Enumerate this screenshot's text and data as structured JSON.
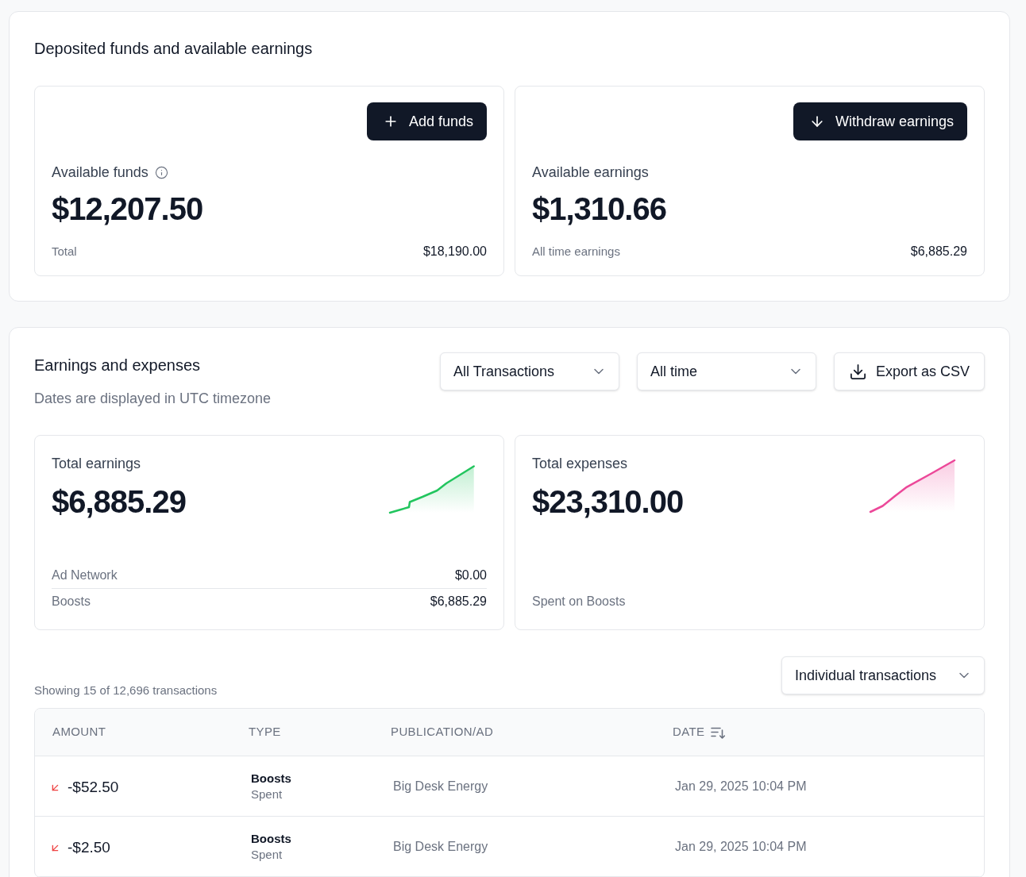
{
  "funds_section": {
    "title": "Deposited funds and available earnings",
    "cards": [
      {
        "kind": "funds",
        "button": "Add funds",
        "label": "Available funds",
        "info_icon": true,
        "amount": "$12,207.50",
        "footer_label": "Total",
        "footer_value": "$18,190.00"
      },
      {
        "kind": "earnings",
        "button": "Withdraw earnings",
        "label": "Available earnings",
        "info_icon": false,
        "amount": "$1,310.66",
        "footer_label": "All time earnings",
        "footer_value": "$6,885.29"
      }
    ]
  },
  "earnings_section": {
    "title": "Earnings and expenses",
    "subtitle": "Dates are displayed in UTC timezone",
    "filters": [
      {
        "value": "All Transactions"
      },
      {
        "value": "All time"
      }
    ],
    "export_button": "Export as CSV",
    "cards": [
      {
        "kind": "earnings",
        "label": "Total earnings",
        "amount": "$6,885.29",
        "color": "#22c55e",
        "rows": [
          {
            "label": "Ad Network",
            "value": "$0.00"
          },
          {
            "label": "Boosts",
            "value": "$6,885.29"
          }
        ]
      },
      {
        "kind": "expenses",
        "label": "Total expenses",
        "amount": "$23,310.00",
        "color": "#ec4899",
        "rows": [
          {
            "label": "Spent on Boosts"
          }
        ]
      }
    ],
    "view_select": {
      "value": "Individual transactions"
    },
    "count_text": "Showing 15 of 12,696 transactions",
    "table": {
      "columns": [
        {
          "label": "AMOUNT",
          "sorted": false
        },
        {
          "label": "TYPE",
          "sorted": false
        },
        {
          "label": "PUBLICATION/AD",
          "sorted": false
        },
        {
          "label": "DATE",
          "sorted": true
        }
      ],
      "rows": [
        {
          "kind": "expense",
          "amount": "-$52.50",
          "type": "Boosts",
          "subtype": "Spent",
          "publication": "Big Desk Energy",
          "date": "Jan 29, 2025 10:04 PM"
        },
        {
          "kind": "expense",
          "amount": "-$2.50",
          "type": "Boosts",
          "subtype": "Spent",
          "publication": "Big Desk Energy",
          "date": "Jan 29, 2025 10:04 PM"
        }
      ]
    }
  }
}
